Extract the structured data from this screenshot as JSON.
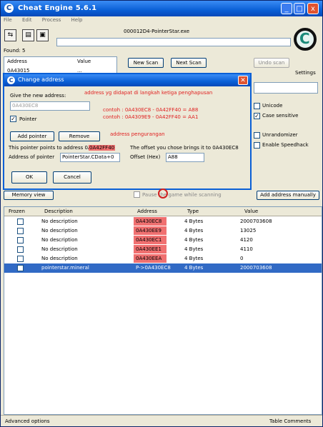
{
  "window": {
    "title": "Cheat Engine 5.6.1",
    "controls": [
      "_",
      "□",
      "x"
    ]
  },
  "menu": [
    "File",
    "Edit",
    "Process",
    "Help"
  ],
  "process_label": "000012D4-PointerStar.exe",
  "found_label": "Found: 5",
  "results": {
    "headers": [
      "Address",
      "Value"
    ],
    "row": [
      "0A43015",
      "..."
    ]
  },
  "scan": {
    "new_scan": "New Scan",
    "next_scan": "Next Scan",
    "undo_scan": "Undo scan",
    "settings": "Settings"
  },
  "options": {
    "unicode": "Unicode",
    "case_sensitive": "Case sensitive",
    "unrandomizer": "Unrandomizer",
    "speedhack": "Enable Speedhack"
  },
  "dialog": {
    "title": "Change address",
    "give_address_label": "Give the new address:",
    "address_value": "0A430EC8",
    "pointer_label": "Pointer",
    "note1": "address yg didapat di langkah ketiga penghapusan",
    "note2": "contoh : 0A430EC8 - 0A42FF40 = A88",
    "note3": "contoh : 0A4309E9 - 0A42FF40 = AA1",
    "note4": "address pengurangan",
    "add_pointer": "Add pointer",
    "remove": "Remove",
    "points_to": "This pointer points to address 0A42FF40",
    "points_to_highlight": "0A42FF40",
    "address_of_pointer_label": "Address of pointer",
    "address_of_pointer_value": "PointerStar.CData+0",
    "offset_info": "The offset you chose brings it to 0A430EC8",
    "offset_label": "Offset (Hex)",
    "offset_value": "A88",
    "ok": "OK",
    "cancel": "Cancel"
  },
  "memory_view": "Memory view",
  "pause_label": "Pause the game while scanning",
  "add_address_manually": "Add address manually",
  "table": {
    "headers": [
      "Frozen",
      "Description",
      "Address",
      "Type",
      "Value"
    ],
    "rows": [
      {
        "desc": "No description",
        "addr": "0A430EC8",
        "type": "4 Bytes",
        "value": "2000703608",
        "selected": false
      },
      {
        "desc": "No description",
        "addr": "0A430EE9",
        "type": "4 Bytes",
        "value": "13025",
        "selected": false
      },
      {
        "desc": "No description",
        "addr": "0A430EC1",
        "type": "4 Bytes",
        "value": "4120",
        "selected": false
      },
      {
        "desc": "No description",
        "addr": "0A430EE1",
        "type": "4 Bytes",
        "value": "4110",
        "selected": false
      },
      {
        "desc": "No description",
        "addr": "0A430EEA",
        "type": "4 Bytes",
        "value": "0",
        "selected": false
      },
      {
        "desc": "pointerstar.mineral",
        "addr": "P->0A430EC8",
        "type": "4 Bytes",
        "value": "2000703608",
        "selected": true
      }
    ]
  },
  "status": {
    "left": "Advanced options",
    "right": "Table Comments"
  },
  "colors": {
    "titlebar": "#0a5fd6",
    "highlight": "#f07070",
    "selection": "#316ac5",
    "note": "#e02020"
  }
}
